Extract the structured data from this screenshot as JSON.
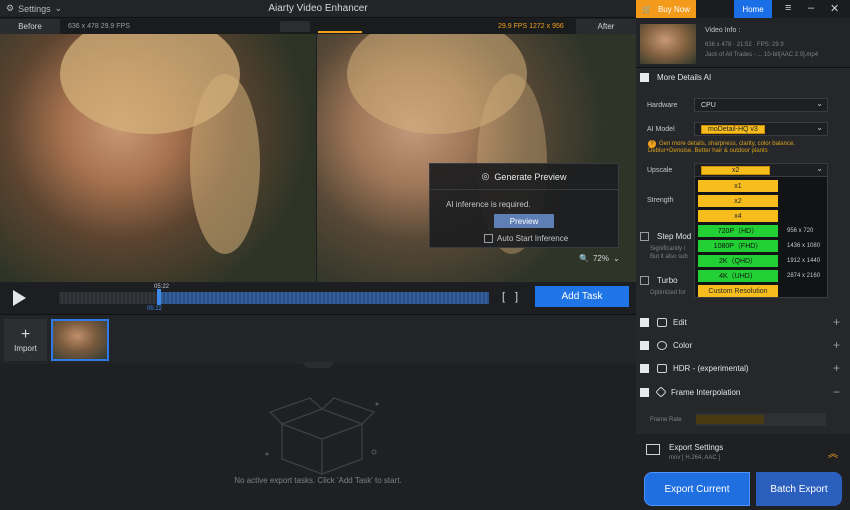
{
  "topbar": {
    "settings_label": "Settings",
    "title": "Aiarty Video Enhancer",
    "buy_now": "Buy Now",
    "home": "Home"
  },
  "video_header": {
    "before": "Before",
    "after": "After",
    "left_info": "636 x 478  29.9 FPS",
    "right_info": "29.9 FPS  1272 x 956"
  },
  "preview": {
    "title": "Generate Preview",
    "message": "AI inference is required.",
    "button": "Preview",
    "auto_start": "Auto Start Inference",
    "zoom": "72%"
  },
  "timeline": {
    "timecode_top": "05:22",
    "timecode_bottom": "05:22",
    "add_task": "Add Task"
  },
  "tasks": {
    "import_label": "Import",
    "empty_message": "No active export tasks. Click 'Add Task' to start."
  },
  "video_info": {
    "label": "Video Info :",
    "details": "636 x 478 · 21:52 · FPS: 29.9",
    "filename": "Jack of All Trades - ... 10-bit[AAC 2.0].mp4"
  },
  "more_details": {
    "title": "More Details AI",
    "hardware_label": "Hardware",
    "hardware_value": "CPU",
    "model_label": "AI Model",
    "model_value": "moDetail-HQ  v3",
    "description": "Gen more details, sharpness, clarity, color balance. Deblur+Denoise. Better hair & outdoor plants",
    "upscale_label": "Upscale",
    "upscale_value": "x2",
    "strength_label": "Strength",
    "step_label": "Step Mod",
    "step_desc1": "Significantly i",
    "step_desc2": "But it also sub",
    "turbo_label": "Turbo",
    "turbo_desc": "Optimized for"
  },
  "upscale_options": [
    {
      "label": "x1",
      "res": ""
    },
    {
      "label": "x2",
      "res": ""
    },
    {
      "label": "x4",
      "res": ""
    },
    {
      "label": "720P（HD）",
      "res": "956 x 720"
    },
    {
      "label": "1080P（FHD）",
      "res": "1436 x 1080"
    },
    {
      "label": "2K（QHD）",
      "res": "1912 x 1440"
    },
    {
      "label": "4K（UHD）",
      "res": "2874 x 2160"
    },
    {
      "label": "Custom Resolution",
      "res": ""
    }
  ],
  "sections": {
    "edit": "Edit",
    "color": "Color",
    "hdr": "HDR - (experimental)",
    "frame_interp": "Frame Interpolation",
    "frame_rate": "Frame Rate"
  },
  "export": {
    "title": "Export Settings",
    "subtitle": "mov [ H.264, AAC ]",
    "export_current": "Export Current",
    "batch_export": "Batch Export"
  },
  "colors": {
    "accent_blue": "#1f75e6",
    "accent_orange": "#f39a1a",
    "option_green": "#22cf34",
    "option_yellow": "#f7bd1d"
  }
}
